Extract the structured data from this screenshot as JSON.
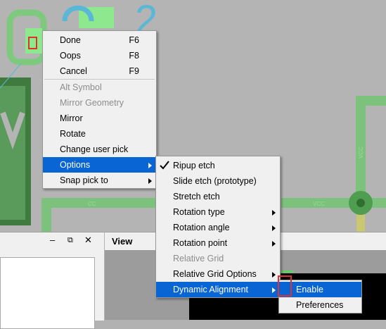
{
  "canvas_labels": {
    "big_text": "2",
    "small_text_1": "CC",
    "small_text_2": "VCC",
    "small_text_3": "VCC"
  },
  "main_menu": {
    "items": [
      {
        "label": "Done",
        "shortcut": "F6",
        "disabled": false
      },
      {
        "label": "Oops",
        "shortcut": "F8",
        "disabled": false
      },
      {
        "label": "Cancel",
        "shortcut": "F9",
        "disabled": false
      },
      {
        "label": "Alt Symbol",
        "shortcut": "",
        "disabled": true
      },
      {
        "label": "Mirror Geometry",
        "shortcut": "",
        "disabled": true
      },
      {
        "label": "Mirror",
        "shortcut": "",
        "disabled": false
      },
      {
        "label": "Rotate",
        "shortcut": "",
        "disabled": false
      },
      {
        "label": "Change user pick",
        "shortcut": "",
        "disabled": false
      },
      {
        "label": "Options",
        "shortcut": "",
        "disabled": false,
        "submenu": true,
        "highlighted": true
      },
      {
        "label": "Snap pick to",
        "shortcut": "",
        "disabled": false,
        "submenu": true
      }
    ]
  },
  "options_menu": {
    "items": [
      {
        "label": "Ripup etch",
        "checked": true
      },
      {
        "label": "Slide etch (prototype)"
      },
      {
        "label": "Stretch etch"
      },
      {
        "label": "Rotation type",
        "submenu": true
      },
      {
        "label": "Rotation angle",
        "submenu": true
      },
      {
        "label": "Rotation point",
        "submenu": true
      },
      {
        "label": "Relative Grid",
        "disabled": true
      },
      {
        "label": "Relative Grid Options",
        "submenu": true
      },
      {
        "label": "Dynamic Alignment",
        "submenu": true,
        "highlighted": true
      }
    ]
  },
  "dynamic_menu": {
    "items": [
      {
        "label": "Enable",
        "highlighted": true
      },
      {
        "label": "Preferences"
      }
    ]
  },
  "left_panel": {
    "minimize": "–",
    "restore": "⧉",
    "close": "✕"
  },
  "view_panel": {
    "title": "View"
  },
  "colors": {
    "highlight": "#0a65d4",
    "menu_bg": "#f0f0f0",
    "trace_green": "#72c472",
    "cyan": "#5ab7d6",
    "marker_red": "#e03030"
  }
}
